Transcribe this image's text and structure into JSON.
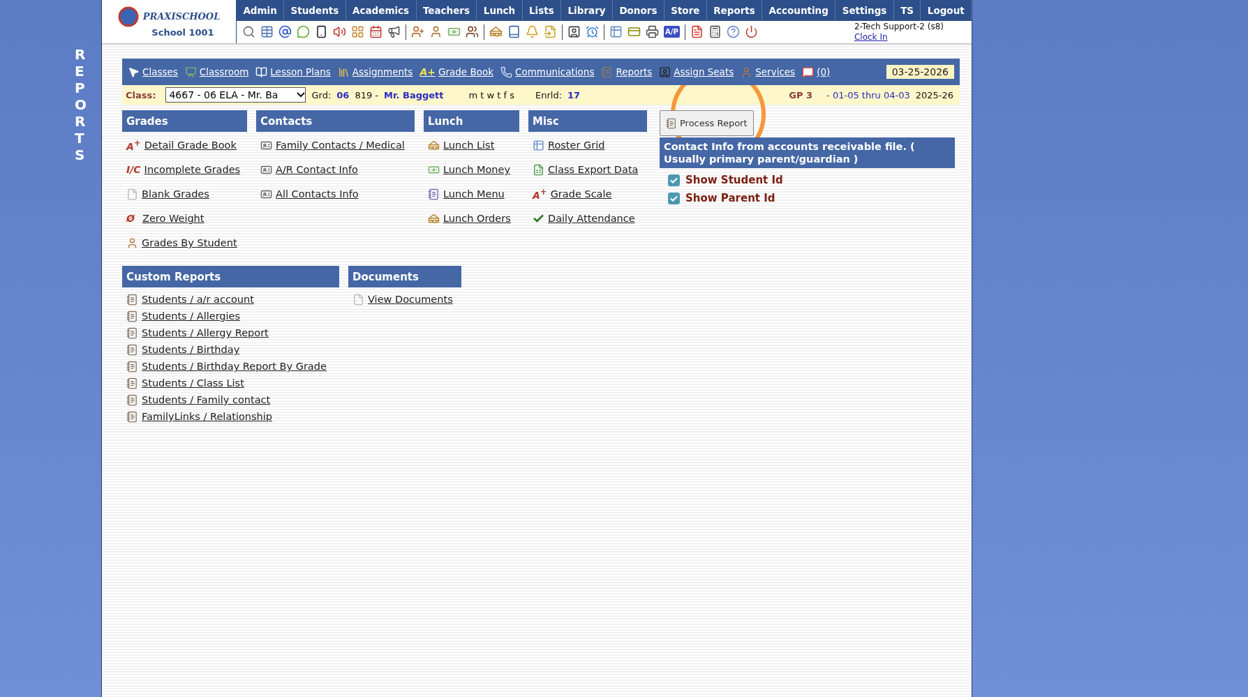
{
  "side_title": "REPORTS",
  "logo": {
    "name": "PRAXISCHOOL",
    "school": "School 1001"
  },
  "menu": [
    "Admin",
    "Students",
    "Academics",
    "Teachers",
    "Lunch",
    "Lists",
    "Library",
    "Donors",
    "Store",
    "Reports",
    "Accounting",
    "Settings",
    "TS",
    "Logout"
  ],
  "toolbar_badge": "A/P",
  "user": {
    "name": "2-Tech Support-2 (s8)",
    "link": "Clock In"
  },
  "class_nav": {
    "items": [
      {
        "kind": "pointer",
        "label": "Classes"
      },
      {
        "kind": "board",
        "label": "Classroom"
      },
      {
        "kind": "book",
        "label": "Lesson Plans"
      },
      {
        "kind": "books",
        "label": "Assignments"
      },
      {
        "kind": "badge",
        "badge": "A+",
        "label": "Grade Book"
      },
      {
        "kind": "phone",
        "label": "Communications"
      },
      {
        "kind": "report",
        "label": "Reports"
      },
      {
        "kind": "seat",
        "label": "Assign Seats"
      },
      {
        "kind": "person",
        "label": "Services"
      },
      {
        "kind": "chat",
        "label": "(0)"
      }
    ],
    "date": "03-25-2026"
  },
  "class_bar": {
    "class_label": "Class:",
    "class_value": "4667 - 06 ELA - Mr. Ba",
    "grade_label": "Grd:",
    "grade": "06",
    "room": "819 -",
    "teacher": "Mr. Baggett",
    "days": "m t w t f s",
    "enrolled_label": "Enrld:",
    "enrolled": "17",
    "period": "GP 3",
    "range": "- 01-05 thru 04-03",
    "year": "2025-26"
  },
  "sections": [
    {
      "title": "Grades",
      "items": [
        {
          "kind": "badge",
          "badge": "A$^{+}$",
          "label": "Detail Grade Book"
        },
        {
          "kind": "badge",
          "badge": "I/C",
          "label": "Incomplete Grades"
        },
        {
          "kind": "page",
          "label": "Blank Grades"
        },
        {
          "kind": "badge",
          "badge": "Ø",
          "label": "Zero Weight"
        },
        {
          "kind": "person",
          "label": "Grades By Student"
        }
      ]
    },
    {
      "title": "Contacts",
      "items": [
        {
          "kind": "card",
          "label": "Family Contacts / Medical"
        },
        {
          "kind": "card",
          "label": "A/R Contact Info"
        },
        {
          "kind": "card",
          "label": "All Contacts Info"
        }
      ]
    },
    {
      "title": "Lunch",
      "items": [
        {
          "kind": "burger",
          "label": "Lunch List"
        },
        {
          "kind": "money",
          "label": "Lunch Money"
        },
        {
          "kind": "menu",
          "label": "Lunch Menu"
        },
        {
          "kind": "burger",
          "label": "Lunch Orders"
        }
      ]
    },
    {
      "title": "Misc",
      "items": [
        {
          "kind": "grid",
          "label": "Roster Grid"
        },
        {
          "kind": "sheet",
          "label": "Class Export Data"
        },
        {
          "kind": "badge",
          "badge": "A$^{+}$",
          "label": "Grade Scale"
        },
        {
          "kind": "check",
          "label": "Daily Attendance"
        }
      ]
    }
  ],
  "custom_reports": {
    "title": "Custom Reports",
    "items": [
      {
        "kind": "report",
        "label": "Students / a/r account"
      },
      {
        "kind": "report",
        "label": "Students / Allergies"
      },
      {
        "kind": "report",
        "label": "Students / Allergy Report"
      },
      {
        "kind": "report",
        "label": "Students / Birthday"
      },
      {
        "kind": "report",
        "label": "Students / Birthday Report By Grade"
      },
      {
        "kind": "report",
        "label": "Students / Class List"
      },
      {
        "kind": "report",
        "label": "Students / Family contact"
      },
      {
        "kind": "report",
        "label": "FamilyLinks / Relationship"
      }
    ]
  },
  "documents": {
    "title": "Documents",
    "items": [
      {
        "kind": "page",
        "label": "View Documents"
      }
    ]
  },
  "report_panel": {
    "button": "Process Report",
    "heading": "Contact Info from accounts receivable file. ( Usually primary parent/guardian )",
    "options": [
      {
        "label": "Show Student Id",
        "checked": true
      },
      {
        "label": "Show Parent Id",
        "checked": true
      }
    ]
  }
}
